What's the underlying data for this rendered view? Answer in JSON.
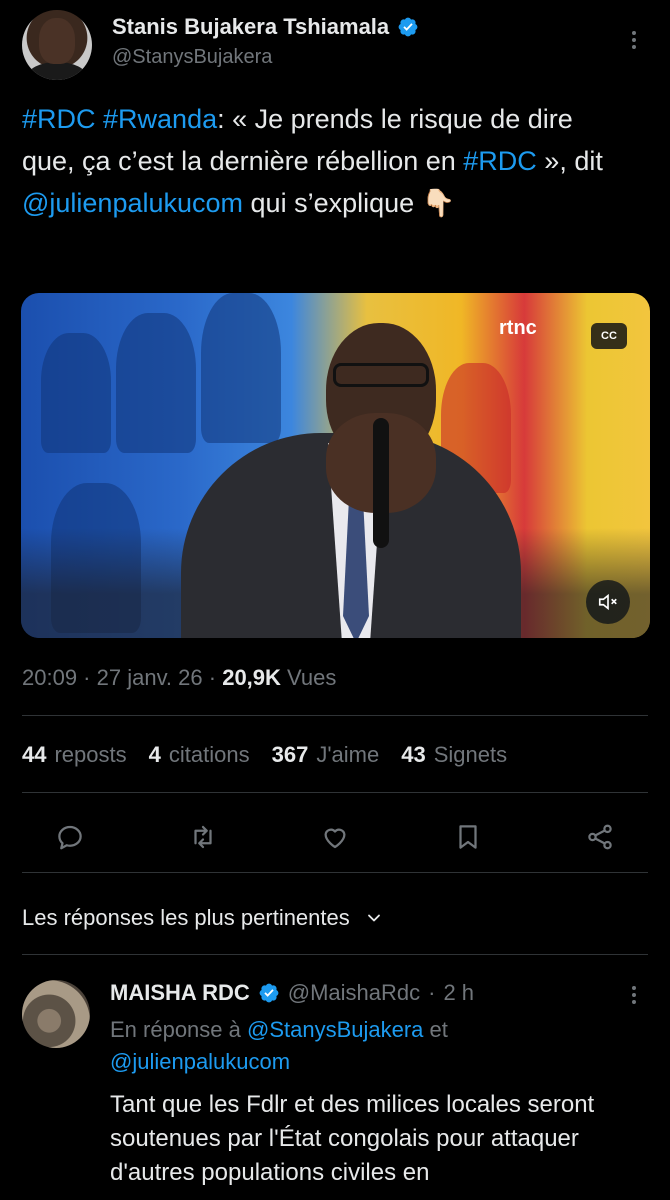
{
  "author": {
    "name": "Stanis Bujakera Tshiamala",
    "handle": "@StanysBujakera"
  },
  "tweet": {
    "tag_rdc": "#RDC",
    "tag_rwanda": "#Rwanda",
    "text_1": ": « Je prends le risque de dire que, ça c’est la dernière rébellion en ",
    "tag_rdc2": "#RDC",
    "text_2": " », dit ",
    "mention": "@julienpalukucom",
    "text_3": " qui s’explique",
    "emoji": "👇🏻"
  },
  "media": {
    "logo_text": "rtnc",
    "cc_label": "CC"
  },
  "meta": {
    "time": "20:09",
    "date": "27 janv. 26",
    "views_count": "20,9K",
    "views_label": "Vues"
  },
  "stats": {
    "reposts_count": "44",
    "reposts_label": "reposts",
    "quotes_count": "4",
    "quotes_label": "citations",
    "likes_count": "367",
    "likes_label": "J'aime",
    "bookmarks_count": "43",
    "bookmarks_label": "Signets"
  },
  "replies_sort": {
    "label": "Les réponses les plus pertinentes"
  },
  "reply": {
    "name": "MAISHA RDC",
    "handle": "@MaishaRdc",
    "time": "2 h",
    "in_reply_prefix": "En réponse à ",
    "in_reply_user1": "@StanysBujakera",
    "in_reply_and": " et",
    "in_reply_user2": "@julienpalukucom",
    "text": "Tant que les Fdlr et des milices locales seront soutenues par l'État congolais pour attaquer d'autres populations civiles en"
  },
  "colors": {
    "background": "#000000",
    "link_blue": "#1d9bf0",
    "muted_grey": "#71767b",
    "text": "#e7e9ea"
  },
  "icons": [
    "verified-badge-icon",
    "more-options-icon",
    "reply-icon",
    "repost-icon",
    "like-icon",
    "bookmark-icon",
    "share-icon",
    "chevron-down-icon",
    "mute-icon"
  ]
}
